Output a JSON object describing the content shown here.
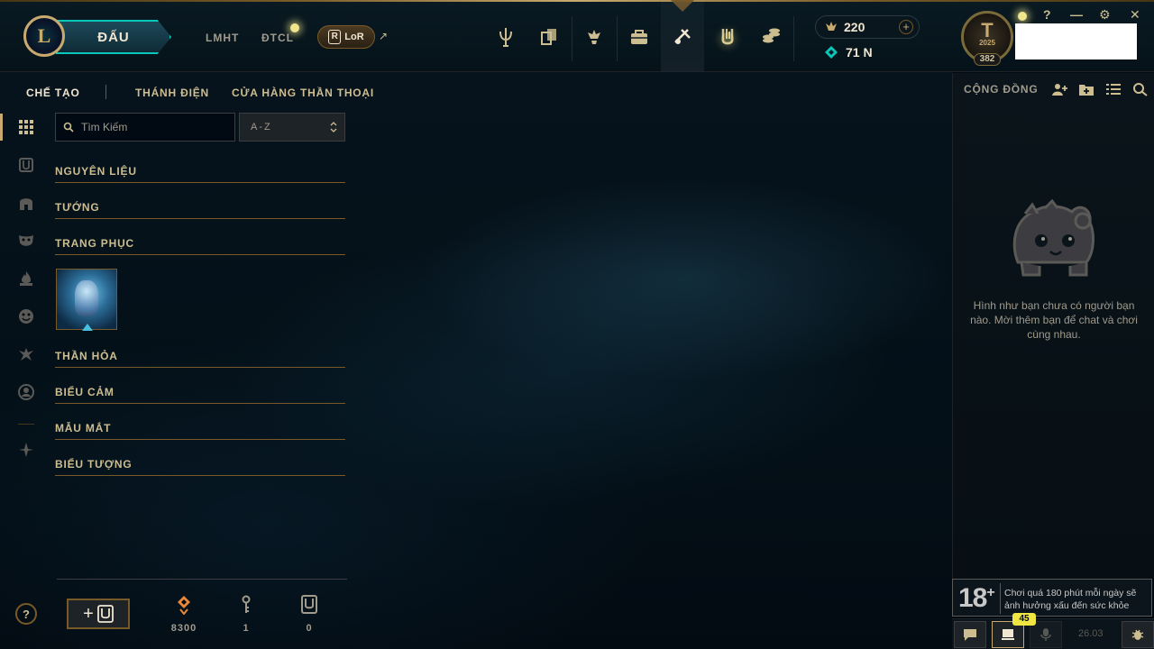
{
  "header": {
    "logo_letter": "L",
    "play_label": "ĐẤU",
    "nav": [
      "LMHT",
      "ĐTCL"
    ],
    "lor_label": "LoR",
    "lor_glyph": "R",
    "external_arrow": "↗",
    "nav_icons": [
      "home-trident-icon",
      "collection-cards-icon",
      "clash-trophy-icon",
      "profile-bag-icon",
      "loot-crafting-icon",
      "collection-emblem-icon",
      "store-coins-icon"
    ],
    "active_nav_icon": "loot-crafting-icon",
    "currency": {
      "blue_essence": "220",
      "riot_points": "71 N",
      "add_label": "+"
    },
    "profile": {
      "year_badge": "2025",
      "level": "382",
      "avatar_glyph": "T"
    },
    "window_controls": {
      "help": "?",
      "minimize": "—",
      "settings": "⚙",
      "close": "✕"
    }
  },
  "subnav": {
    "tabs": [
      "CHẾ TẠO",
      "THÁNH ĐIỆN",
      "CỬA HÀNG THẦN THOẠI"
    ],
    "active": "CHẾ TẠO"
  },
  "sidebar": {
    "icons": [
      "grid-all-icon",
      "emblem-chest-icon",
      "helmet-champion-icon",
      "mask-skin-icon",
      "ward-flame-icon",
      "emote-face-icon",
      "eternal-icon",
      "profile-icon-icon",
      "star-emblem-icon"
    ]
  },
  "loot": {
    "search_placeholder": "Tìm Kiếm",
    "sort": {
      "selected": "A-Z",
      "arrows": "⌃⌄"
    },
    "categories": [
      "NGUYÊN LIỆU",
      "TƯỚNG",
      "TRANG PHỤC",
      "THẦN HỎA",
      "BIỂU CẢM",
      "MẪU MẮT",
      "BIỂU TƯỢNG"
    ],
    "skin_items_count": 1
  },
  "inventory": {
    "help_label": "?",
    "add_label": "+",
    "items": [
      {
        "icon": "orange-essence-icon",
        "count": "8300",
        "color": "#e8883a"
      },
      {
        "icon": "key-icon",
        "count": "1",
        "color": "#a09b8c"
      },
      {
        "icon": "chest-icon",
        "count": "0",
        "color": "#a09b8c"
      }
    ]
  },
  "social": {
    "title": "CỘNG ĐỒNG",
    "icons": [
      "add-friend-icon",
      "add-folder-icon",
      "list-view-icon",
      "search-icon"
    ],
    "empty_message": "Hình như bạn chưa có người bạn nào. Mời thêm bạn để chat và chơi cùng nhau.",
    "age_rating": "18",
    "age_plus": "+",
    "age_warning": "Chơi quá 180 phút mỗi ngày sẽ ảnh hưởng xấu đến sức khỏe",
    "notification_count": "45",
    "version": "26.03"
  },
  "colors": {
    "gold": "#c8aa6e",
    "gold_dark": "#785a28",
    "teal": "#0ac8b9",
    "bg": "#010a13",
    "badge_yellow": "#f0e641"
  }
}
